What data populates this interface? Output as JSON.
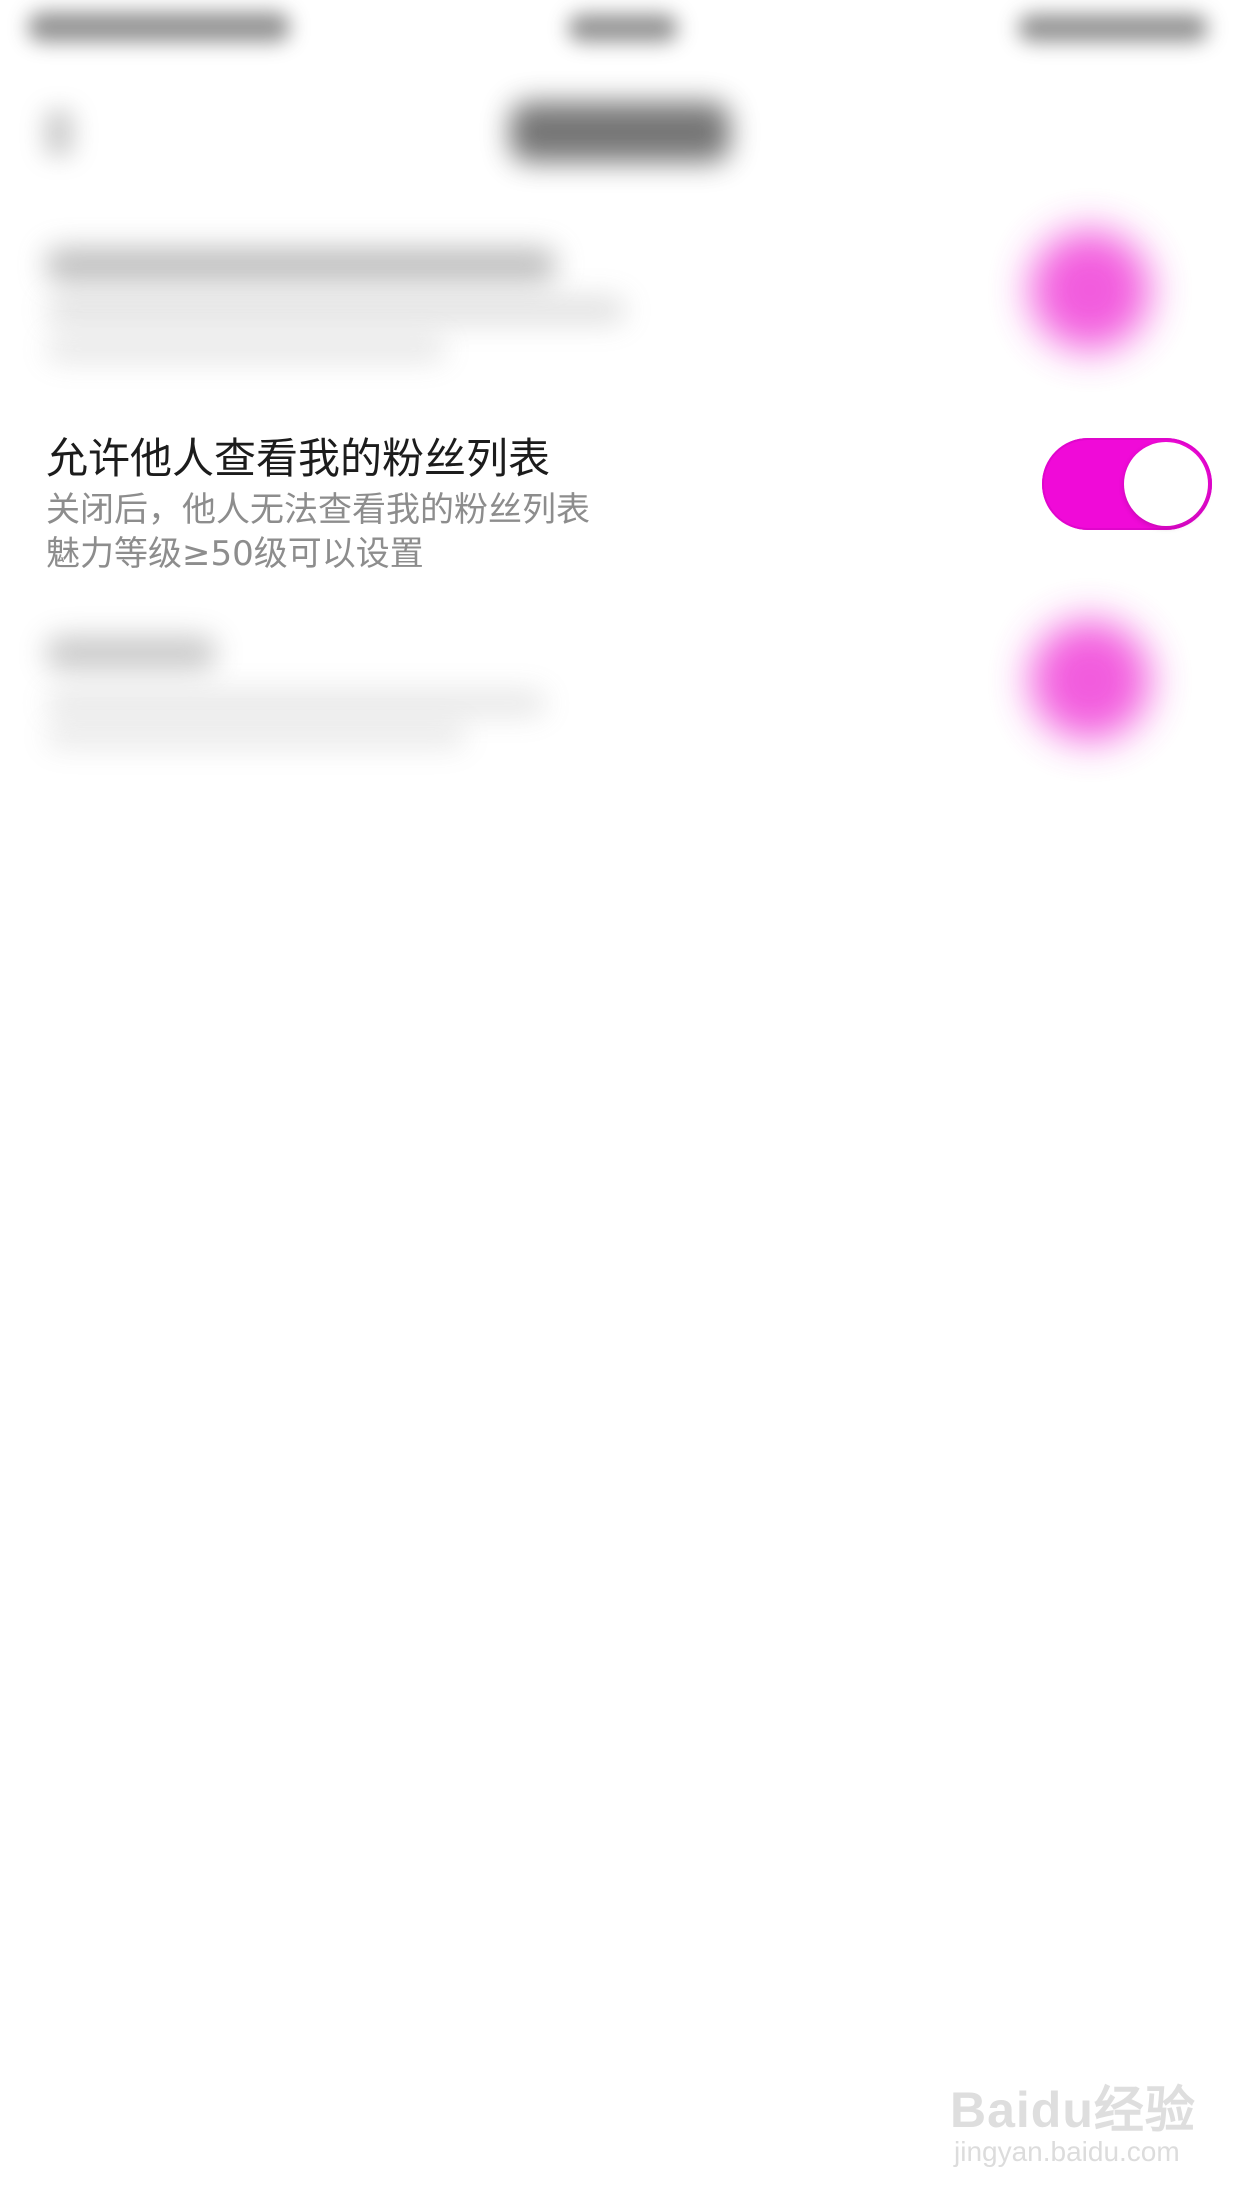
{
  "colors": {
    "accent": "#f00ad8",
    "title_text": "#1c1c1c",
    "secondary_text": "#8d8d8d"
  },
  "setting": {
    "title": "允许他人查看我的粉丝列表",
    "description_line1": "关闭后，他人无法查看我的粉丝列表",
    "description_line2": "魅力等级≥50级可以设置",
    "toggle_on": true
  },
  "watermark": {
    "logo_text": "Baidu经验",
    "url_text": "jingyan.baidu.com"
  }
}
